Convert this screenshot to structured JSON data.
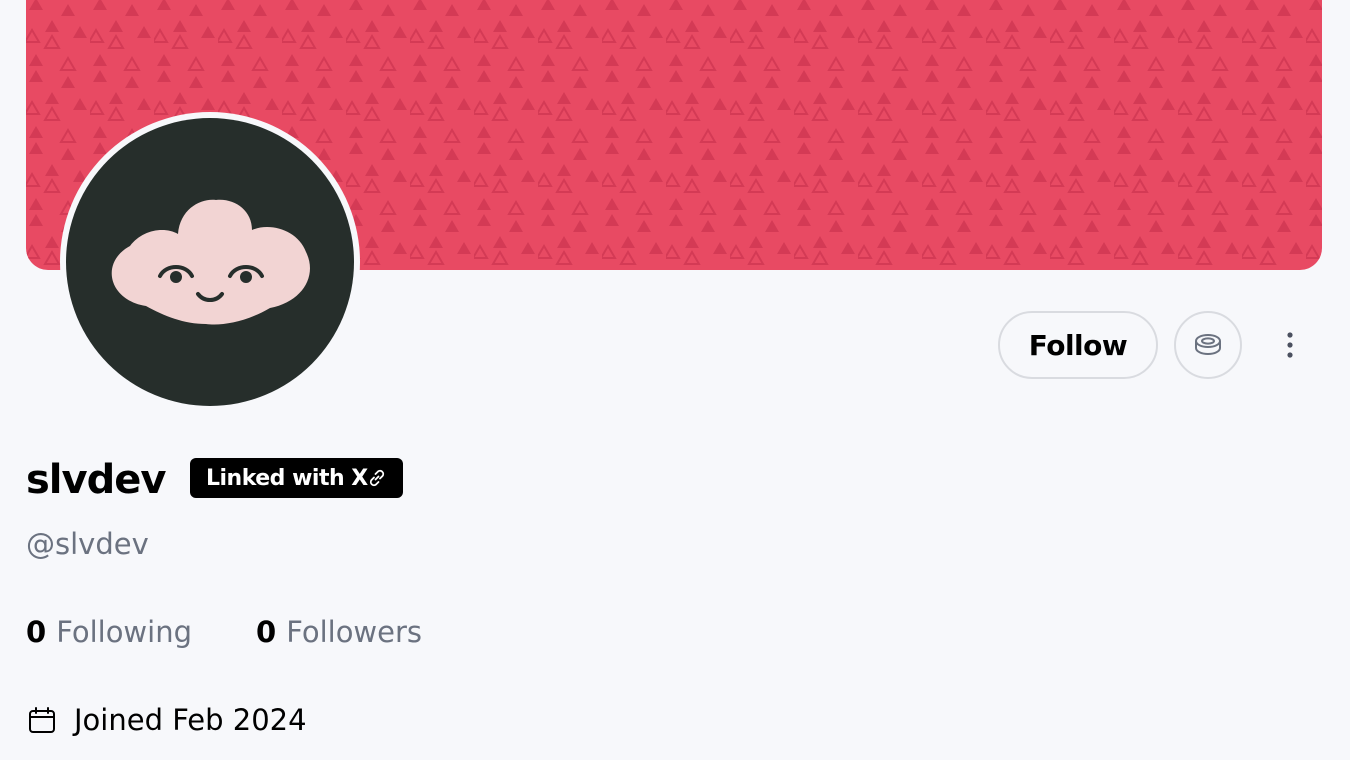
{
  "profile": {
    "display_name": "slvdev",
    "handle": "@slvdev",
    "linked_badge": "Linked with X",
    "following_count": "0",
    "following_label": "Following",
    "followers_count": "0",
    "followers_label": "Followers",
    "joined": "Joined Feb 2024"
  },
  "actions": {
    "follow_label": "Follow"
  },
  "icons": {
    "coin": "coin-stack-icon",
    "more": "vertical-ellipsis-icon",
    "link": "link-icon",
    "calendar": "calendar-icon"
  },
  "colors": {
    "banner": "#e84a63",
    "banner_pattern": "#d43a55",
    "avatar_bg": "#262e2b",
    "avatar_face": "#f2d4d3",
    "muted_text": "#6b7280",
    "page_bg": "#f7f8fb"
  }
}
